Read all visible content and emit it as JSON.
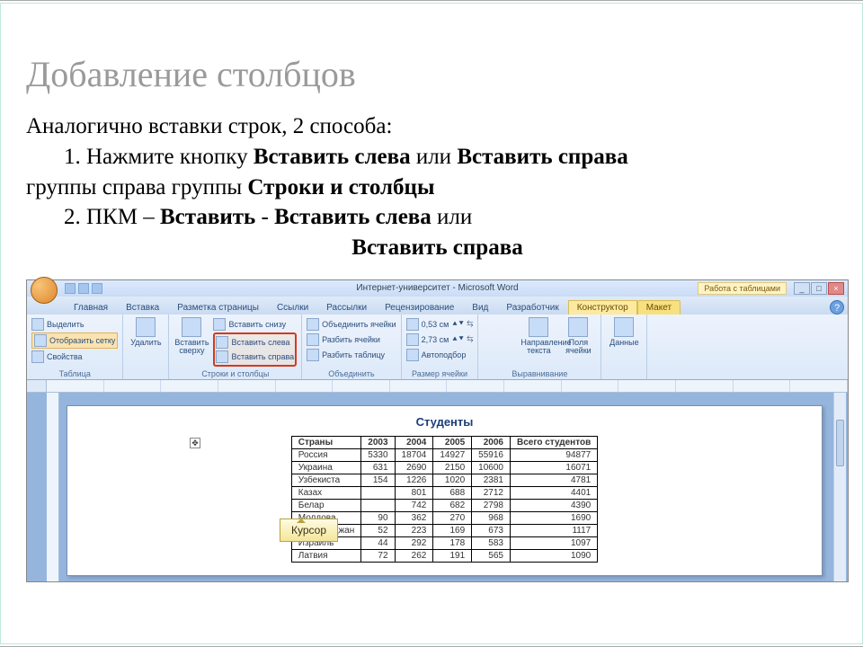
{
  "title": "Добавление столбцов",
  "intro": "Аналогично вставки строк, 2 способа:",
  "step1_a": "1. Нажмите кнопку ",
  "step1_b1": "Вставить слева",
  "step1_mid": " или ",
  "step1_b2": "Вставить справа",
  "step1_grp_pre": " группы ",
  "step1_grp": "Строки и столбцы",
  "step2_a": "2. ПКМ – Вставить - ",
  "step2_b": "Вставить слева",
  "step2_mid": " или",
  "step2_b2": "Вставить справа",
  "word": {
    "title": "Интернет-университет - Microsoft Word",
    "table_tools": "Работа с таблицами",
    "tabs": [
      "Главная",
      "Вставка",
      "Разметка страницы",
      "Ссылки",
      "Рассылки",
      "Рецензирование",
      "Вид",
      "Разработчик",
      "Конструктор",
      "Макет"
    ],
    "groups": {
      "t": {
        "label": "Таблица",
        "select": "Выделить",
        "grid": "Отобразить сетку",
        "props": "Свойства"
      },
      "del": "Удалить",
      "rc": {
        "label": "Строки и столбцы",
        "above": "Вставить сверху",
        "below": "Вставить снизу",
        "left": "Вставить слева",
        "right": "Вставить справа"
      },
      "merge": {
        "label": "Объединить",
        "mc": "Объединить ячейки",
        "sc": "Разбить ячейки",
        "st": "Разбить таблицу"
      },
      "size": {
        "label": "Размер ячейки",
        "h": "0,53 см",
        "w": "2,73 см",
        "auto": "Автоподбор"
      },
      "align": {
        "label": "Выравнивание",
        "dir": "Направление текста",
        "mar": "Поля ячейки"
      },
      "data": "Данные"
    },
    "doc_title": "Студенты",
    "cursor_label": "Курсор",
    "headers": [
      "Страны",
      "2003",
      "2004",
      "2005",
      "2006",
      "Всего студентов"
    ],
    "rows": [
      [
        "Россия",
        "5330",
        "18704",
        "14927",
        "55916",
        "94877"
      ],
      [
        "Украина",
        "631",
        "2690",
        "2150",
        "10600",
        "16071"
      ],
      [
        "Узбекиста",
        "154",
        "1226",
        "1020",
        "2381",
        "4781"
      ],
      [
        "Казах",
        "",
        "801",
        "688",
        "2712",
        "4401"
      ],
      [
        "Белар",
        "",
        "742",
        "682",
        "2798",
        "4390"
      ],
      [
        "Молдова",
        "90",
        "362",
        "270",
        "968",
        "1690"
      ],
      [
        "Азербайджан",
        "52",
        "223",
        "169",
        "673",
        "1117"
      ],
      [
        "Израиль",
        "44",
        "292",
        "178",
        "583",
        "1097"
      ],
      [
        "Латвия",
        "72",
        "262",
        "191",
        "565",
        "1090"
      ]
    ]
  }
}
